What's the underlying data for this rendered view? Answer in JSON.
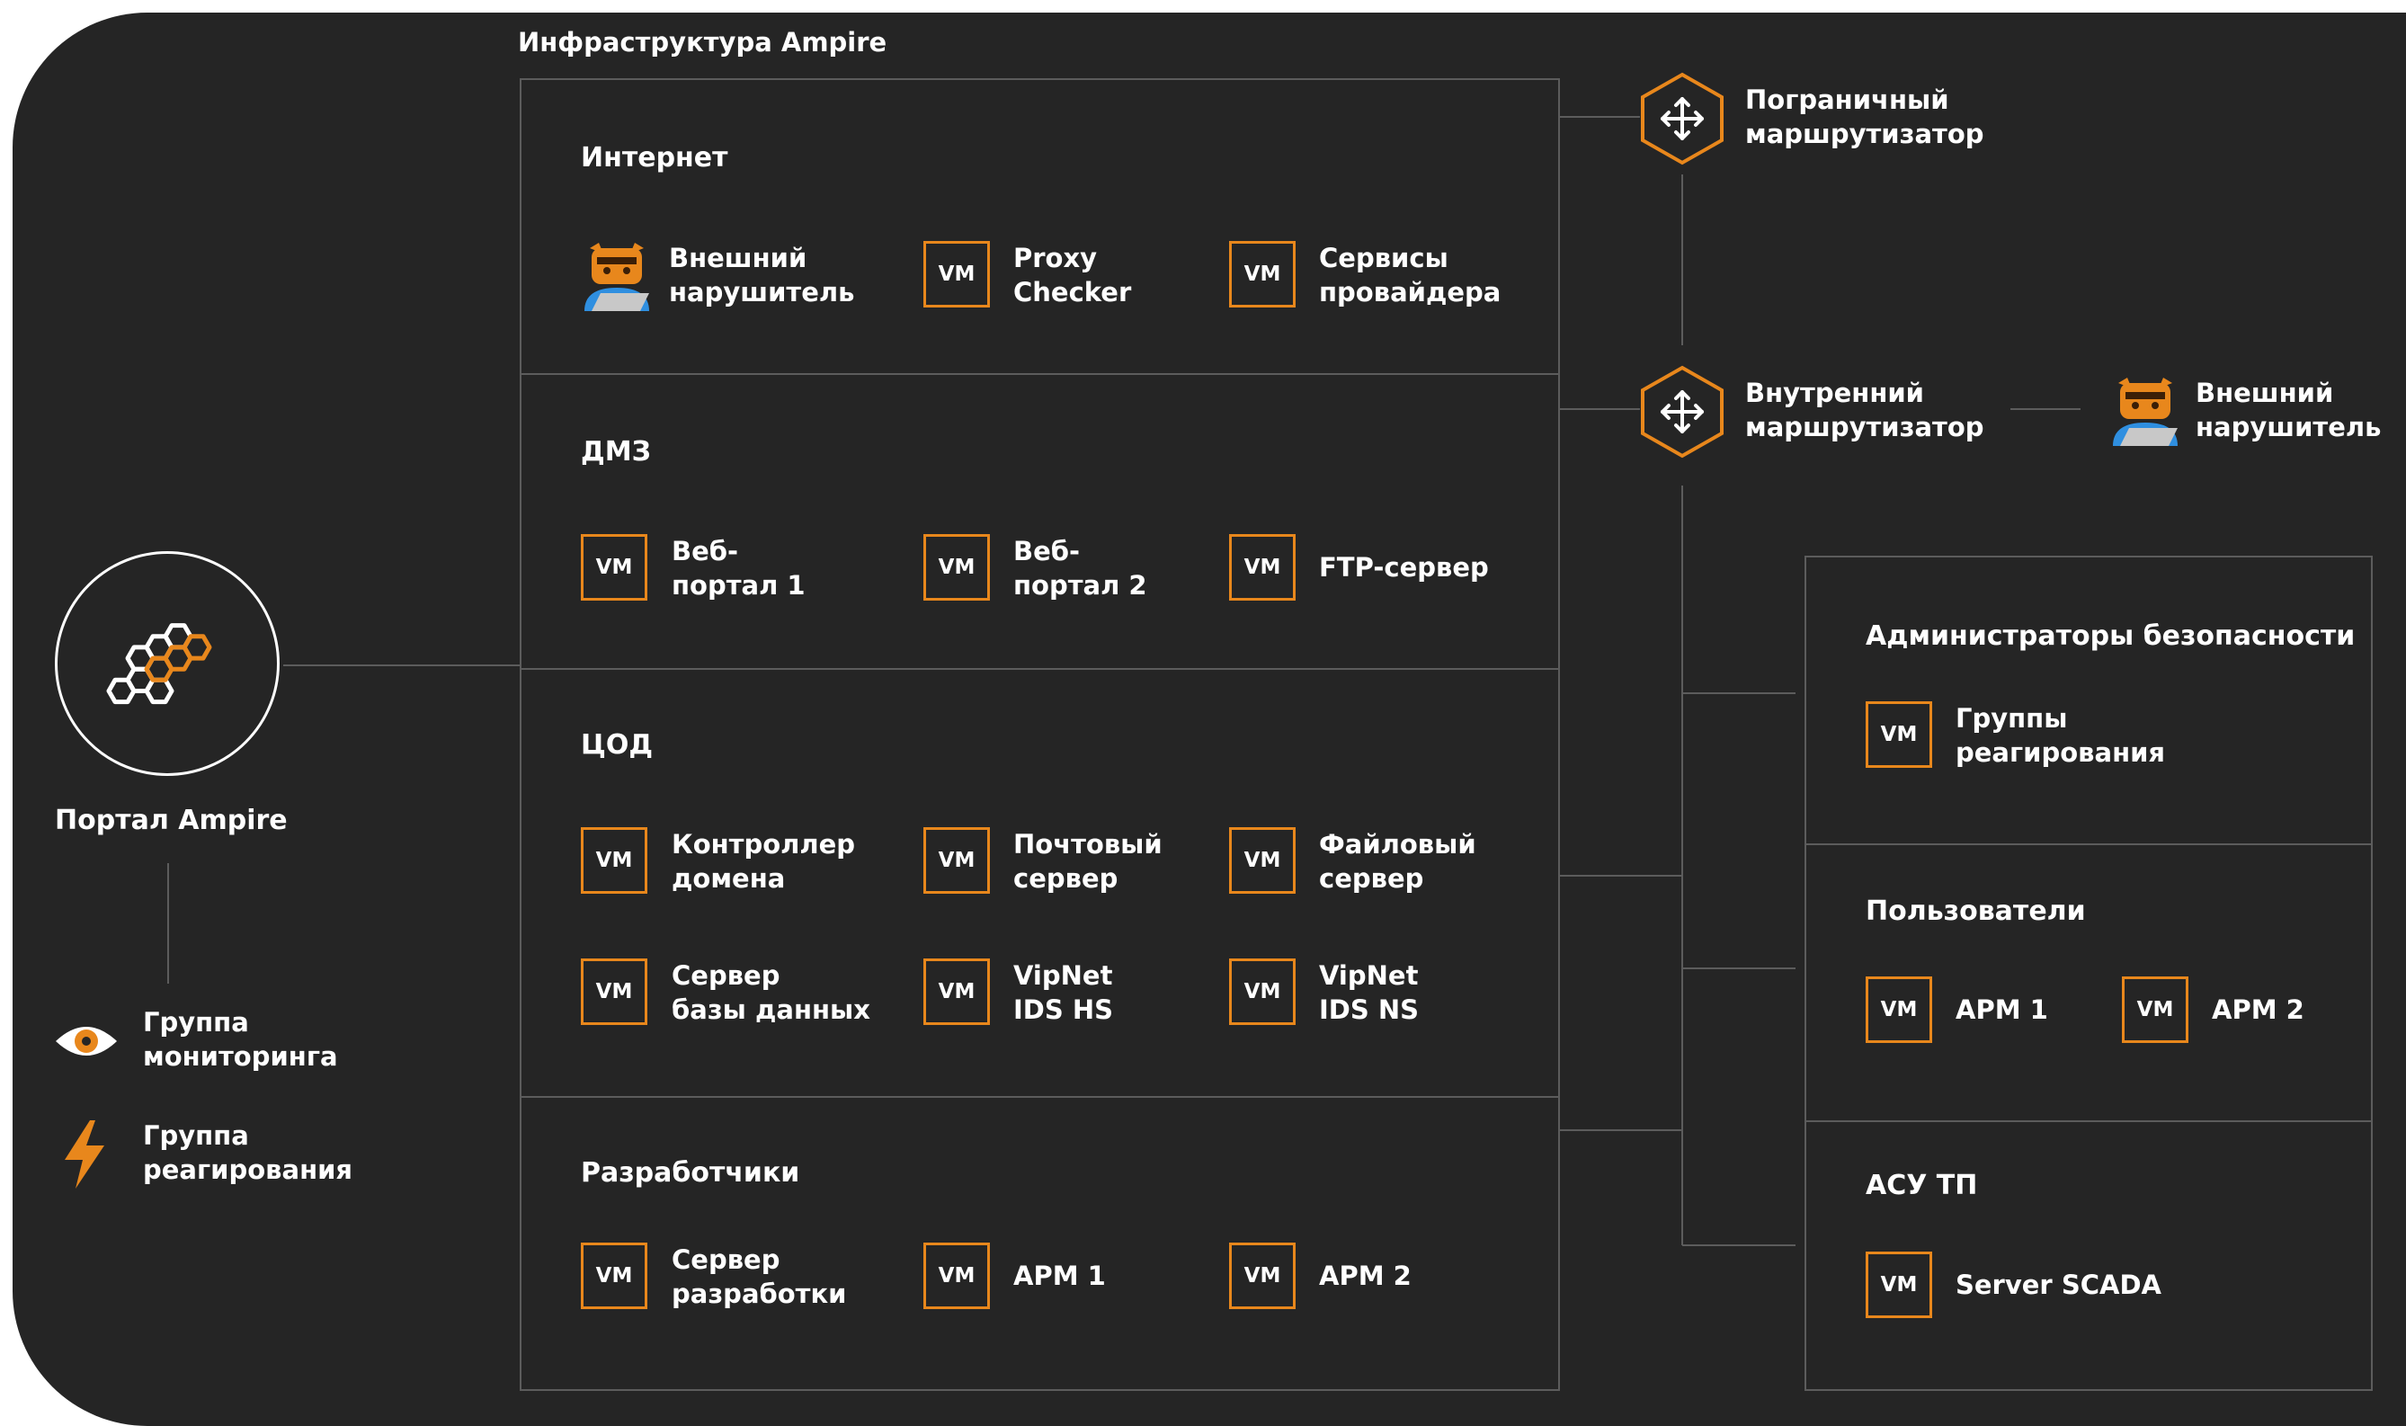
{
  "infra_title": "Инфраструктура Ampire",
  "portal": {
    "label": "Портал Ampire"
  },
  "legend": {
    "monitoring": "Группа\nмониторинга",
    "response": "Группа\nреагирования"
  },
  "vm_badge": "VM",
  "sections": {
    "internet": {
      "title": "Интернет",
      "attacker": "Внешний\nнарушитель",
      "items": [
        "Proxy\nChecker",
        "Сервисы\nпровайдера"
      ]
    },
    "dmz": {
      "title": "ДМЗ",
      "items": [
        "Веб-\nпортал 1",
        "Веб-\nпортал 2",
        "FTP-сервер"
      ]
    },
    "dc": {
      "title": "ЦОД",
      "items": [
        "Контроллер\nдомена",
        "Почтовый\nсервер",
        "Файловый\nсервер",
        "Сервер\nбазы данных",
        "VipNet\nIDS HS",
        "VipNet\nIDS NS"
      ]
    },
    "dev": {
      "title": "Разработчики",
      "items": [
        "Сервер\nразработки",
        "АРМ 1",
        "АРМ 2"
      ]
    }
  },
  "routers": {
    "border": "Пограничный\nмаршрутизатор",
    "internal": "Внутренний\nмаршрутизатор"
  },
  "right_attacker": "Внешний\nнарушитель",
  "right_sections": {
    "admins": {
      "title": "Администраторы безопасности",
      "items": [
        "Группы\nреагирования"
      ]
    },
    "users": {
      "title": "Пользователи",
      "items": [
        "АРМ 1",
        "АРМ 2"
      ]
    },
    "scada": {
      "title": "АСУ ТП",
      "items": [
        "Server SCADA"
      ]
    }
  },
  "colors": {
    "background": "#252525",
    "accent": "#e8871c",
    "line": "#5c5c5c",
    "text": "#ffffff"
  }
}
